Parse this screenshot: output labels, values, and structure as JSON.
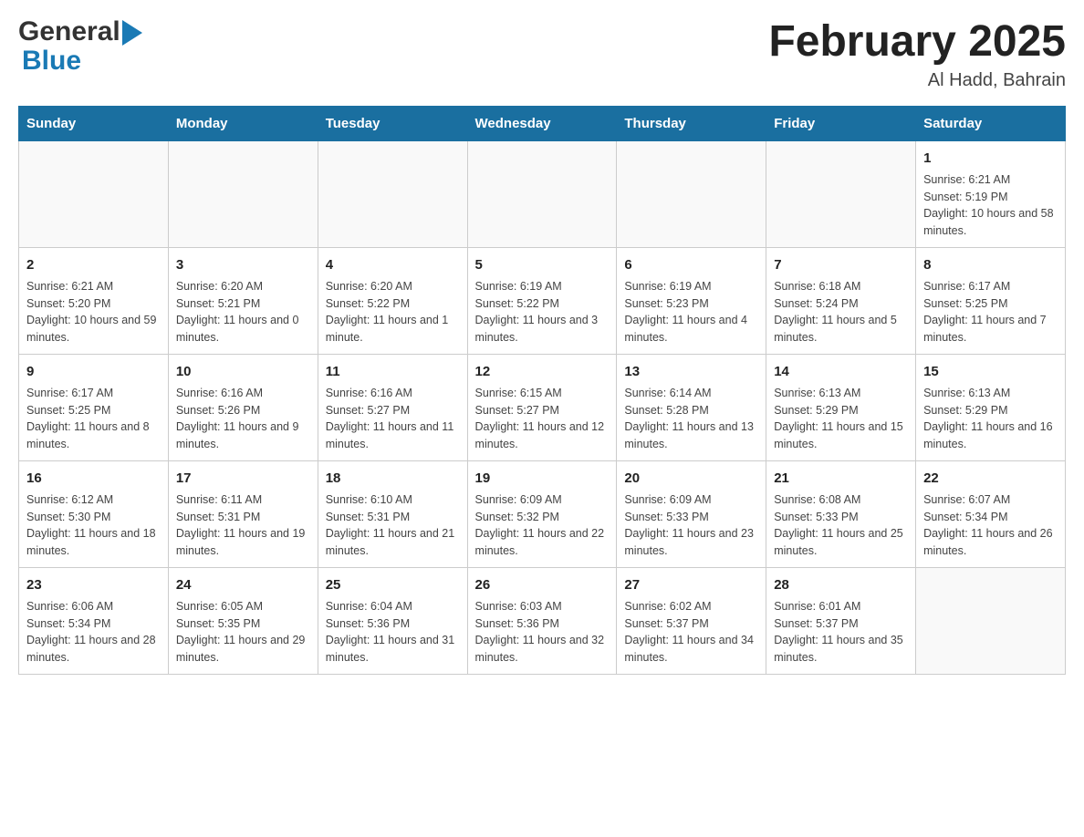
{
  "header": {
    "logo_general": "General",
    "logo_blue": "Blue",
    "title": "February 2025",
    "location": "Al Hadd, Bahrain"
  },
  "days_of_week": [
    "Sunday",
    "Monday",
    "Tuesday",
    "Wednesday",
    "Thursday",
    "Friday",
    "Saturday"
  ],
  "weeks": [
    {
      "cells": [
        {
          "day": "",
          "info": ""
        },
        {
          "day": "",
          "info": ""
        },
        {
          "day": "",
          "info": ""
        },
        {
          "day": "",
          "info": ""
        },
        {
          "day": "",
          "info": ""
        },
        {
          "day": "",
          "info": ""
        },
        {
          "day": "1",
          "info": "Sunrise: 6:21 AM\nSunset: 5:19 PM\nDaylight: 10 hours and 58 minutes."
        }
      ]
    },
    {
      "cells": [
        {
          "day": "2",
          "info": "Sunrise: 6:21 AM\nSunset: 5:20 PM\nDaylight: 10 hours and 59 minutes."
        },
        {
          "day": "3",
          "info": "Sunrise: 6:20 AM\nSunset: 5:21 PM\nDaylight: 11 hours and 0 minutes."
        },
        {
          "day": "4",
          "info": "Sunrise: 6:20 AM\nSunset: 5:22 PM\nDaylight: 11 hours and 1 minute."
        },
        {
          "day": "5",
          "info": "Sunrise: 6:19 AM\nSunset: 5:22 PM\nDaylight: 11 hours and 3 minutes."
        },
        {
          "day": "6",
          "info": "Sunrise: 6:19 AM\nSunset: 5:23 PM\nDaylight: 11 hours and 4 minutes."
        },
        {
          "day": "7",
          "info": "Sunrise: 6:18 AM\nSunset: 5:24 PM\nDaylight: 11 hours and 5 minutes."
        },
        {
          "day": "8",
          "info": "Sunrise: 6:17 AM\nSunset: 5:25 PM\nDaylight: 11 hours and 7 minutes."
        }
      ]
    },
    {
      "cells": [
        {
          "day": "9",
          "info": "Sunrise: 6:17 AM\nSunset: 5:25 PM\nDaylight: 11 hours and 8 minutes."
        },
        {
          "day": "10",
          "info": "Sunrise: 6:16 AM\nSunset: 5:26 PM\nDaylight: 11 hours and 9 minutes."
        },
        {
          "day": "11",
          "info": "Sunrise: 6:16 AM\nSunset: 5:27 PM\nDaylight: 11 hours and 11 minutes."
        },
        {
          "day": "12",
          "info": "Sunrise: 6:15 AM\nSunset: 5:27 PM\nDaylight: 11 hours and 12 minutes."
        },
        {
          "day": "13",
          "info": "Sunrise: 6:14 AM\nSunset: 5:28 PM\nDaylight: 11 hours and 13 minutes."
        },
        {
          "day": "14",
          "info": "Sunrise: 6:13 AM\nSunset: 5:29 PM\nDaylight: 11 hours and 15 minutes."
        },
        {
          "day": "15",
          "info": "Sunrise: 6:13 AM\nSunset: 5:29 PM\nDaylight: 11 hours and 16 minutes."
        }
      ]
    },
    {
      "cells": [
        {
          "day": "16",
          "info": "Sunrise: 6:12 AM\nSunset: 5:30 PM\nDaylight: 11 hours and 18 minutes."
        },
        {
          "day": "17",
          "info": "Sunrise: 6:11 AM\nSunset: 5:31 PM\nDaylight: 11 hours and 19 minutes."
        },
        {
          "day": "18",
          "info": "Sunrise: 6:10 AM\nSunset: 5:31 PM\nDaylight: 11 hours and 21 minutes."
        },
        {
          "day": "19",
          "info": "Sunrise: 6:09 AM\nSunset: 5:32 PM\nDaylight: 11 hours and 22 minutes."
        },
        {
          "day": "20",
          "info": "Sunrise: 6:09 AM\nSunset: 5:33 PM\nDaylight: 11 hours and 23 minutes."
        },
        {
          "day": "21",
          "info": "Sunrise: 6:08 AM\nSunset: 5:33 PM\nDaylight: 11 hours and 25 minutes."
        },
        {
          "day": "22",
          "info": "Sunrise: 6:07 AM\nSunset: 5:34 PM\nDaylight: 11 hours and 26 minutes."
        }
      ]
    },
    {
      "cells": [
        {
          "day": "23",
          "info": "Sunrise: 6:06 AM\nSunset: 5:34 PM\nDaylight: 11 hours and 28 minutes."
        },
        {
          "day": "24",
          "info": "Sunrise: 6:05 AM\nSunset: 5:35 PM\nDaylight: 11 hours and 29 minutes."
        },
        {
          "day": "25",
          "info": "Sunrise: 6:04 AM\nSunset: 5:36 PM\nDaylight: 11 hours and 31 minutes."
        },
        {
          "day": "26",
          "info": "Sunrise: 6:03 AM\nSunset: 5:36 PM\nDaylight: 11 hours and 32 minutes."
        },
        {
          "day": "27",
          "info": "Sunrise: 6:02 AM\nSunset: 5:37 PM\nDaylight: 11 hours and 34 minutes."
        },
        {
          "day": "28",
          "info": "Sunrise: 6:01 AM\nSunset: 5:37 PM\nDaylight: 11 hours and 35 minutes."
        },
        {
          "day": "",
          "info": ""
        }
      ]
    }
  ]
}
